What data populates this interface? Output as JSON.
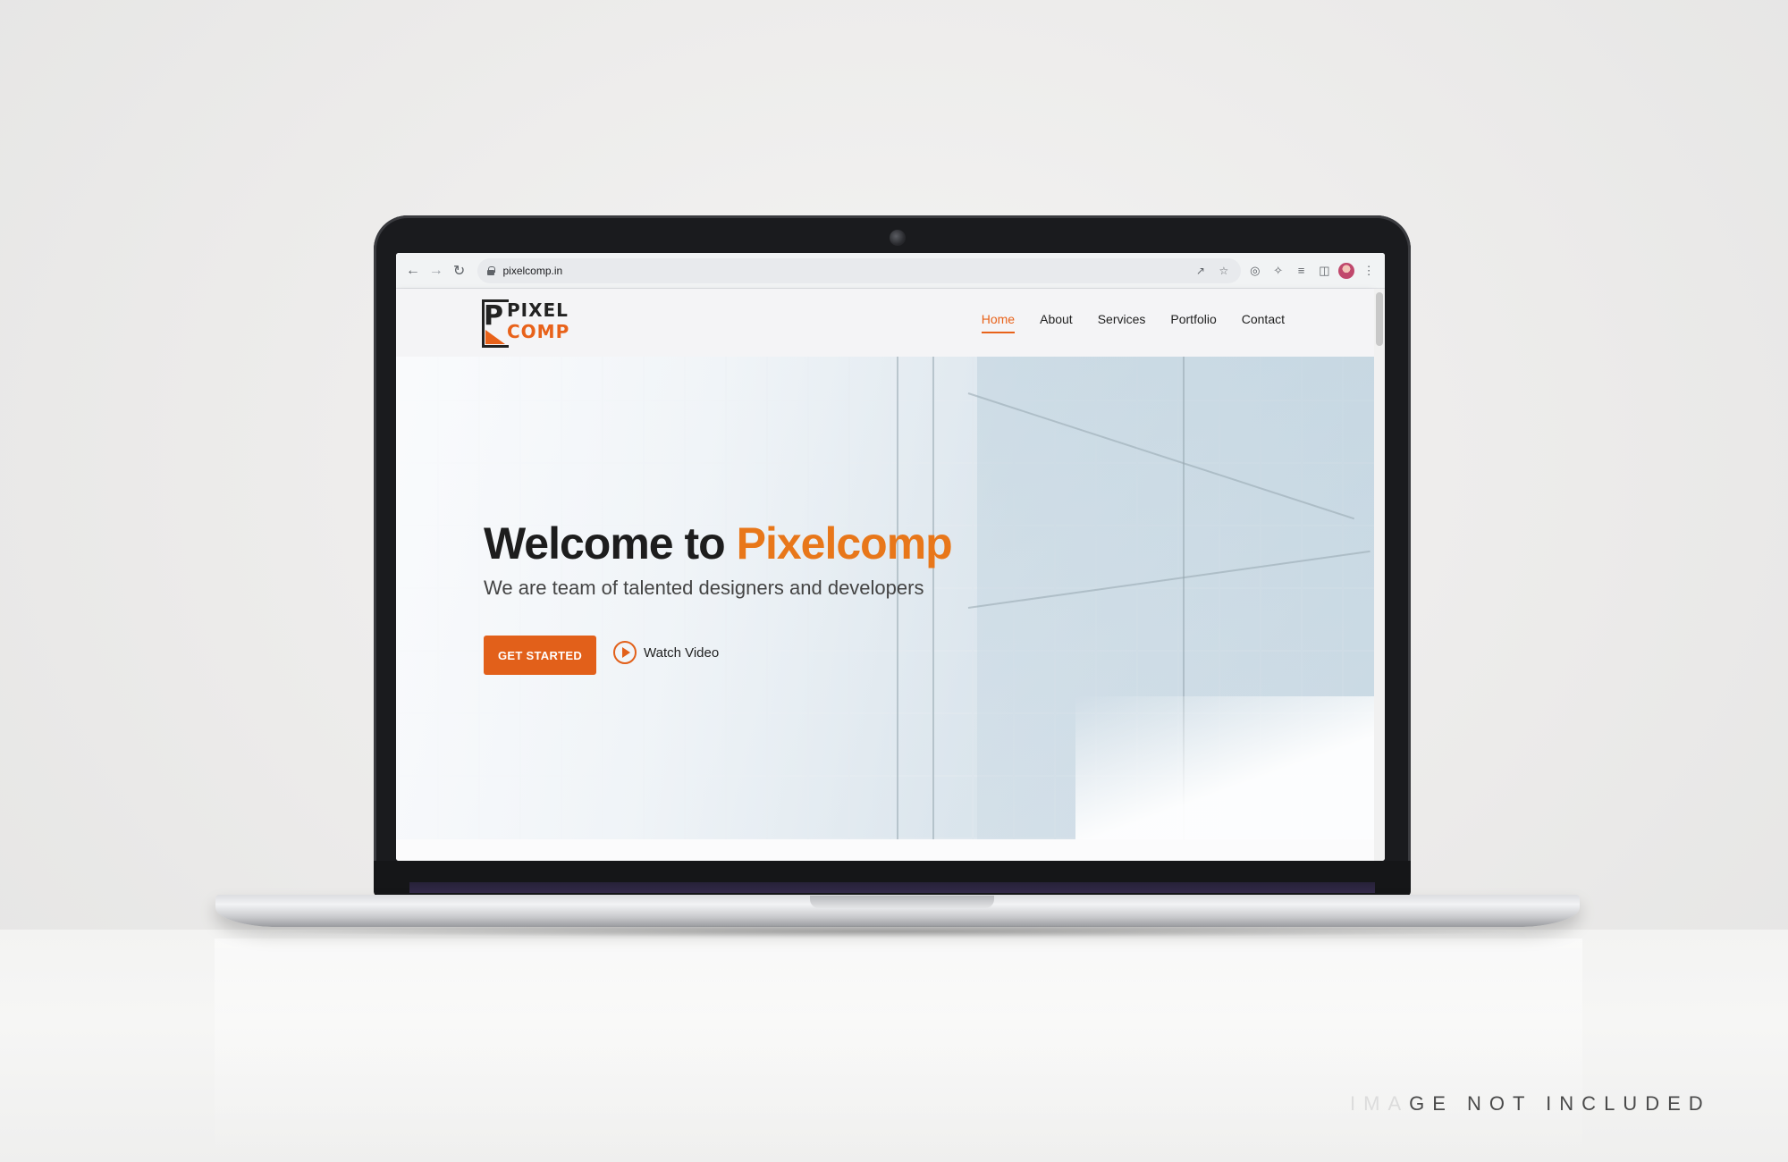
{
  "browser": {
    "back_icon": "arrow-left-icon",
    "forward_icon": "arrow-right-icon",
    "reload_icon": "reload-icon",
    "url": "pixelcomp.in"
  },
  "site": {
    "logo": {
      "line1": "PIXEL",
      "line2": "COMP",
      "letter": "P"
    },
    "nav": [
      {
        "label": "Home",
        "active": true
      },
      {
        "label": "About",
        "active": false
      },
      {
        "label": "Services",
        "active": false
      },
      {
        "label": "Portfolio",
        "active": false
      },
      {
        "label": "Contact",
        "active": false
      }
    ],
    "hero": {
      "title_prefix": "Welcome to ",
      "title_accent": "Pixelcomp",
      "subtitle": "We are team of talented designers and developers",
      "cta_label": "GET STARTED",
      "video_label": "Watch Video"
    },
    "colors": {
      "accent": "#e8621a",
      "button": "#e2601a"
    }
  },
  "watermark": {
    "faded": "IMA",
    "visible": "GE NOT INCLUDED"
  }
}
